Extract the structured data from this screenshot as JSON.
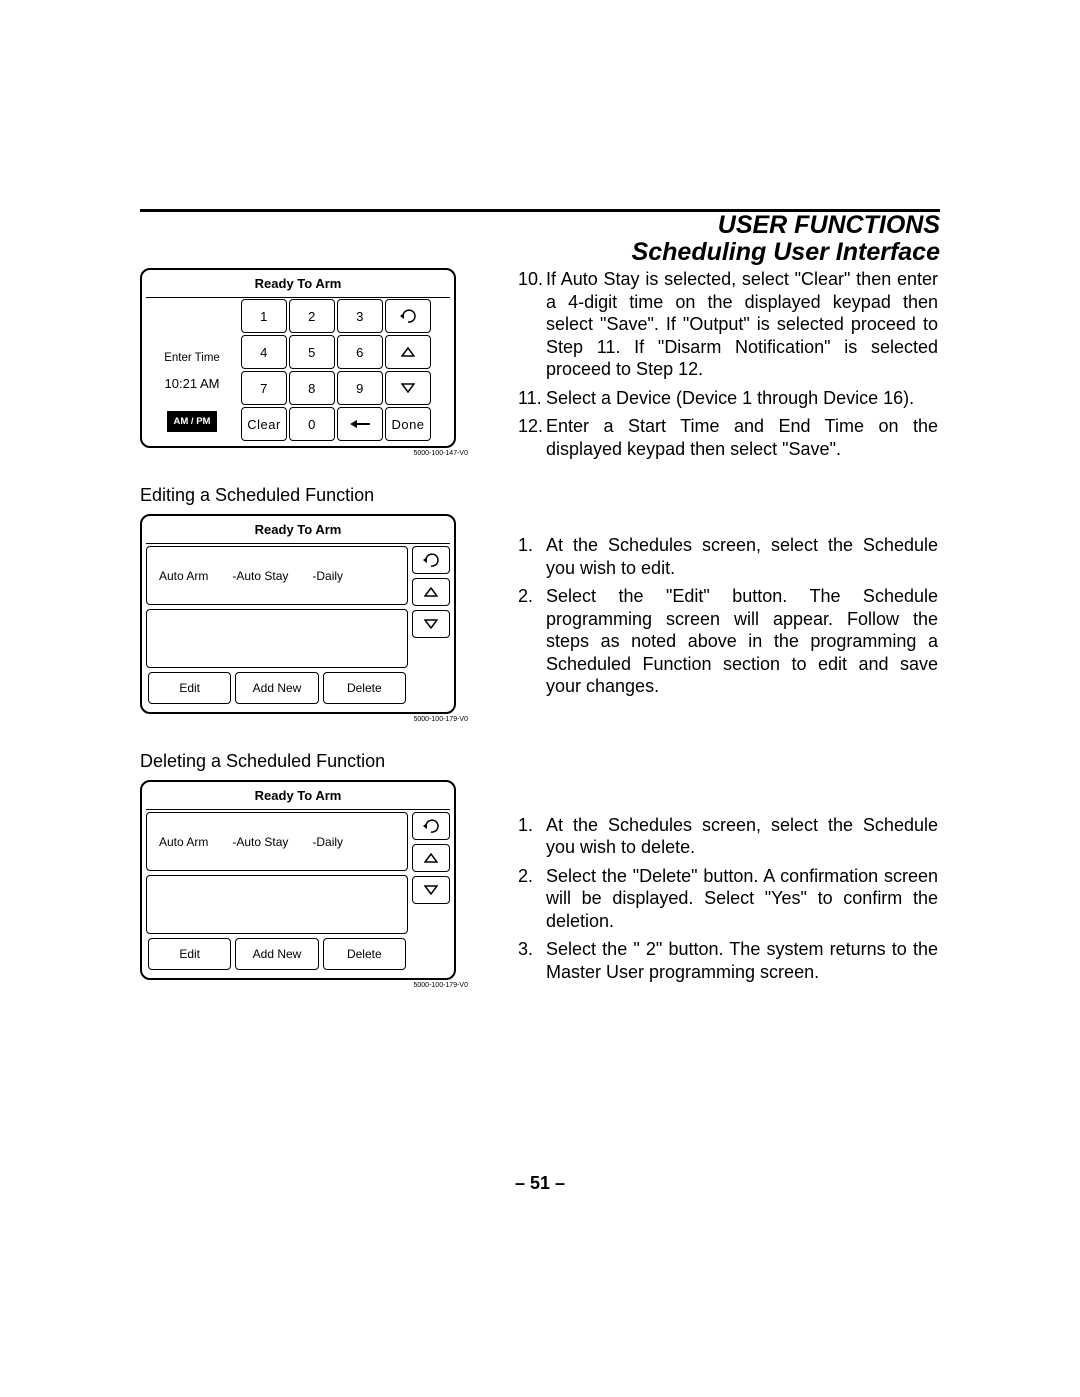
{
  "header": {
    "line1": "USER FUNCTIONS",
    "line2": "Scheduling User Interface"
  },
  "page_number": "– 51 –",
  "steps_10_12": [
    {
      "n": "10.",
      "text": "If Auto Stay is selected, select \"Clear\" then enter a 4-digit time on the displayed keypad then select \"Save\". If \"Output\" is selected proceed to Step 11. If \"Disarm Notification\" is selected proceed to Step 12."
    },
    {
      "n": "11.",
      "text": "Select a Device (Device 1 through Device 16)."
    },
    {
      "n": "12.",
      "text": "Enter a Start Time and End Time on the displayed keypad then select \"Save\"."
    }
  ],
  "edit_heading": "Editing a Scheduled Function",
  "edit_steps": [
    {
      "n": "1.",
      "text": "At the Schedules screen, select the Schedule you wish to edit."
    },
    {
      "n": "2.",
      "text": "Select the \"Edit\" button. The Schedule programming screen will appear. Follow the steps as noted above in the programming a Scheduled Function section to edit and save your changes."
    }
  ],
  "delete_heading": "Deleting a Scheduled Function",
  "delete_steps": [
    {
      "n": "1.",
      "text": "At the Schedules screen, select the Schedule you wish to delete."
    },
    {
      "n": "2.",
      "text": "Select the \"Delete\" button. A confirmation screen will be displayed. Select \"Yes\" to confirm the deletion."
    },
    {
      "n": "3.",
      "text": "Select the \" 2\" button. The system returns to the Master User programming screen."
    }
  ],
  "keypad_panel": {
    "title": "Ready To Arm",
    "left": {
      "enter": "Enter Time",
      "time": "10:21   AM",
      "ampm": "AM / PM"
    },
    "keys": {
      "r1": [
        "1",
        "2",
        "3",
        "back"
      ],
      "r2": [
        "4",
        "5",
        "6",
        "up"
      ],
      "r3": [
        "7",
        "8",
        "9",
        "down"
      ],
      "r4": [
        "Clear",
        "0",
        "left",
        "Done"
      ]
    },
    "doc_id": "5000-100-147-V0"
  },
  "list_panel_edit": {
    "title": "Ready To Arm",
    "row": [
      "Auto Arm",
      "-Auto Stay",
      "-Daily"
    ],
    "buttons": [
      "Edit",
      "Add New",
      "Delete"
    ],
    "doc_id": "5000-100-179-V0"
  },
  "list_panel_delete": {
    "title": "Ready To Arm",
    "row": [
      "Auto Arm",
      "-Auto Stay",
      "-Daily"
    ],
    "buttons": [
      "Edit",
      "Add New",
      "Delete"
    ],
    "doc_id": "5000-100-179-V0"
  }
}
